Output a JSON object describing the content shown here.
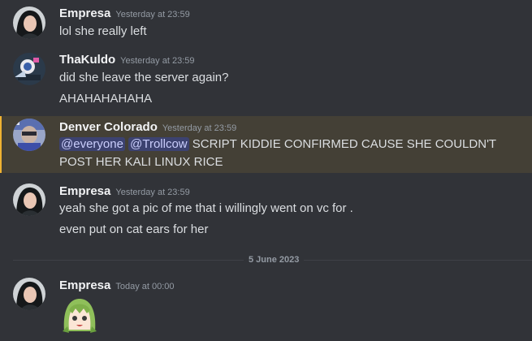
{
  "messages": [
    {
      "username": "Empresa",
      "timestamp": "Yesterday at 23:59",
      "lines": [
        "lol she really left"
      ]
    },
    {
      "username": "ThaKuldo",
      "timestamp": "Yesterday at 23:59",
      "lines": [
        "did she leave the server again?",
        "AHAHAHAHAHA"
      ]
    },
    {
      "username": "Denver Colorado",
      "timestamp": "Yesterday at 23:59",
      "mentions": [
        "@everyone",
        "@Trollcow"
      ],
      "lines": [
        " SCRIPT KIDDIE CONFIRMED CAUSE SHE COULDN'T",
        "POST HER KALI LINUX RICE"
      ]
    },
    {
      "username": "Empresa",
      "timestamp": "Yesterday at 23:59",
      "lines": [
        "yeah she got a pic of me that i willingly went on vc for .",
        "even put on cat ears for her"
      ]
    },
    {
      "username": "Empresa",
      "timestamp": "Today at 00:00",
      "lines": []
    }
  ],
  "date_divider": "5 June 2023",
  "colors": {
    "background": "#313338",
    "mention_highlight": "#444036",
    "mention_bar": "#f0b232",
    "ping_background": "#3c4270",
    "ping_text": "#c9cdfb"
  }
}
